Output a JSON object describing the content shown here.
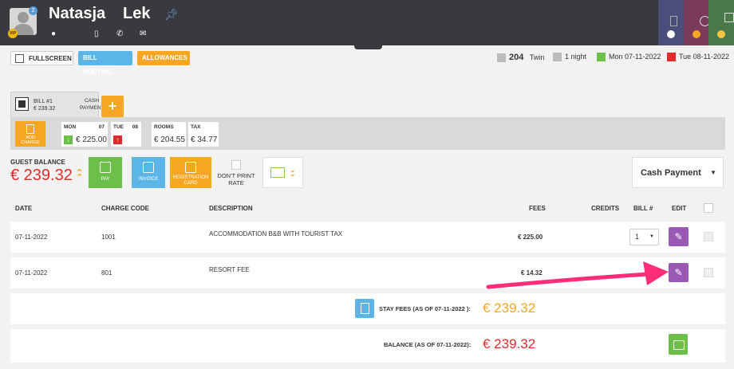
{
  "header": {
    "first_name": "Natasja",
    "last_name": "Lek",
    "notification_count": "2",
    "vip_badge": "VIP"
  },
  "toolbar": {
    "fullscreen": "FULLSCREEN",
    "bill_routing": "BILL ROUTING",
    "allowances": "ALLOWANCES"
  },
  "stay": {
    "room_number": "204",
    "room_type": "Twin",
    "nights": "1 night",
    "arrival": "Mon 07-11-2022",
    "departure": "Tue 08-11-2022"
  },
  "bill": {
    "tab_title": "BILL #1",
    "tab_amount": "€ 239.32",
    "tab_type_line1": "CASH",
    "tab_type_line2": "PAYMENT",
    "add_bill": "+",
    "add_charge_line1": "ADD",
    "add_charge_line2": "CHARGE",
    "days": [
      {
        "day": "MON",
        "date": "07",
        "amount": "€ 225.00",
        "direction": "arrival"
      },
      {
        "day": "TUE",
        "date": "08",
        "amount": "",
        "direction": "departure"
      }
    ],
    "rooms_label": "ROOMS",
    "rooms_amount": "€ 204.55",
    "tax_label": "TAX",
    "tax_amount": "€ 34.77"
  },
  "balance": {
    "label": "GUEST BALANCE",
    "amount": "€ 239.32"
  },
  "actions": {
    "pay": "PAY",
    "invoice": "INVOICE",
    "registration_line1": "REGISTRATION",
    "registration_line2": "CARD",
    "dont_print_line1": "DON'T PRINT",
    "dont_print_line2": "RATE",
    "payment_method": "Cash Payment"
  },
  "table": {
    "headers": {
      "date": "DATE",
      "charge_code": "CHARGE CODE",
      "description": "DESCRIPTION",
      "fees": "FEES",
      "credits": "CREDITS",
      "bill_no": "BILL #",
      "edit": "EDIT"
    },
    "rows": [
      {
        "date": "07-11-2022",
        "code": "1001",
        "description": "ACCOMMODATION B&B WITH TOURIST TAX",
        "fee": "€ 225.00",
        "bill": "1"
      },
      {
        "date": "07-11-2022",
        "code": "801",
        "description": "RESORT FEE",
        "fee": "€ 14.32",
        "bill": ""
      }
    ]
  },
  "summary": {
    "stay_fees_label": "STAY FEES (AS OF  07-11-2022 ):",
    "stay_fees_amount": "€ 239.32",
    "balance_label": "BALANCE (AS OF  07-11-2022):",
    "balance_amount": "€ 239.32"
  },
  "colors": {
    "header_bg": "#3a3a3e",
    "orange": "#f5a623",
    "blue": "#5bb5e6",
    "green": "#6cc04a",
    "purple": "#9b59b6",
    "red": "#e02b2b",
    "annotation_arrow": "#ff2d7a"
  },
  "icons": [
    "pin-icon",
    "location-icon",
    "mobile-icon",
    "phone-icon",
    "email-icon",
    "fullscreen-icon",
    "bed-icon",
    "moon-icon",
    "arrival-arrow-icon",
    "departure-arrow-icon",
    "pencil-icon",
    "wallet-icon",
    "document-icon",
    "chevron-double-down-icon"
  ]
}
